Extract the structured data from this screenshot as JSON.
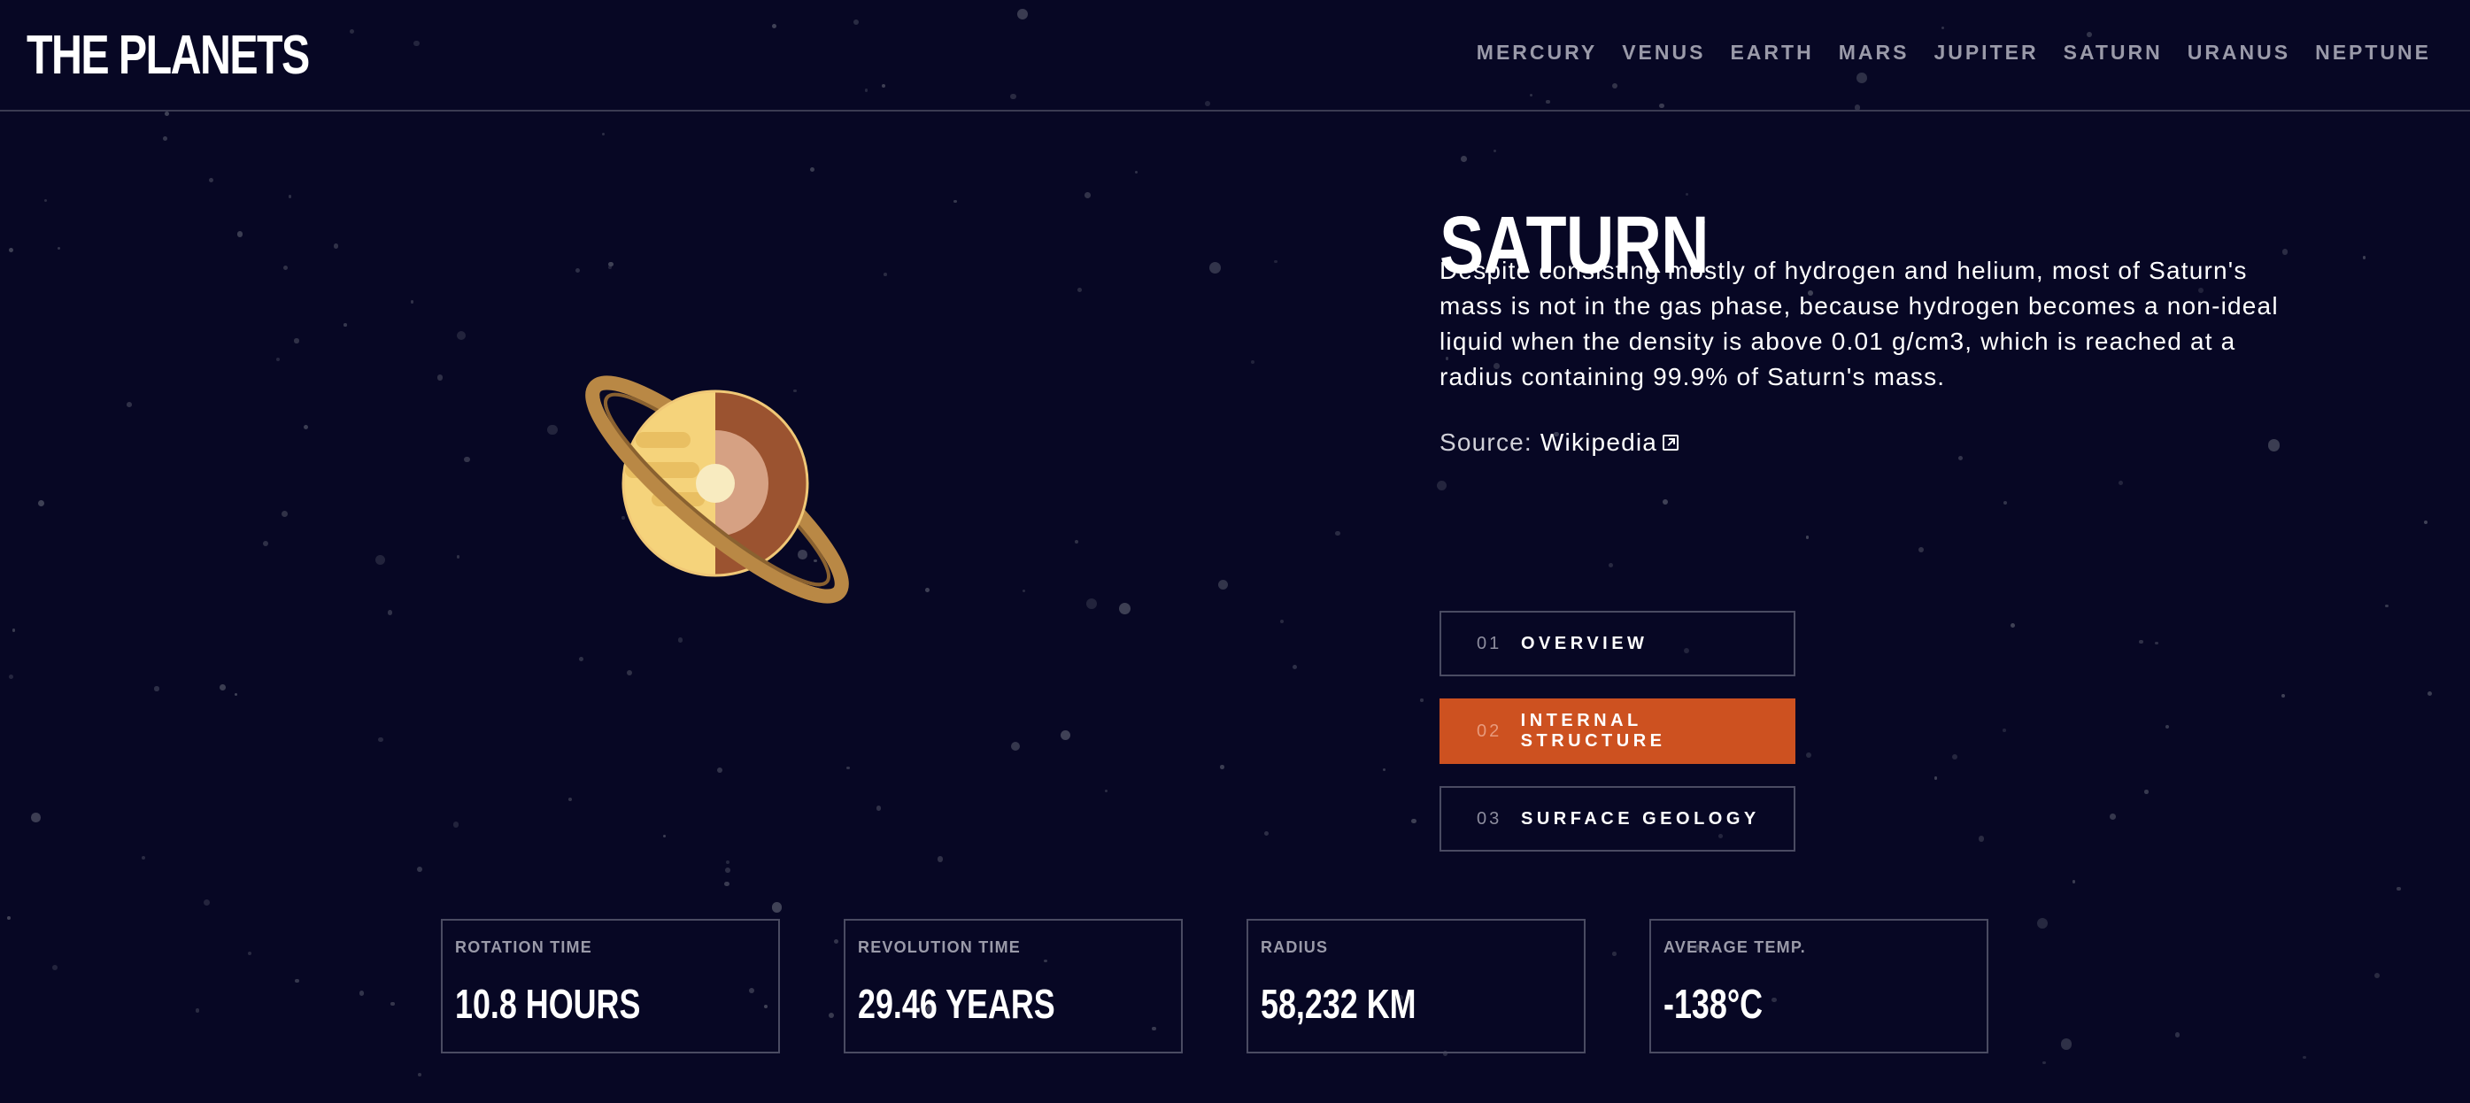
{
  "header": {
    "logo": "THE PLANETS",
    "nav": [
      "MERCURY",
      "VENUS",
      "EARTH",
      "MARS",
      "JUPITER",
      "SATURN",
      "URANUS",
      "NEPTUNE"
    ]
  },
  "planet": {
    "name": "SATURN",
    "description": "Despite consisting mostly of hydrogen and helium, most of Saturn's mass is not in the gas phase, because hydrogen becomes a non-ideal liquid when the density is above 0.01 g/cm3, which is reached at a radius containing 99.9% of Saturn's mass.",
    "source_label": "Source:",
    "source_link": "Wikipedia",
    "source_icon": "external-link-icon"
  },
  "tabs": [
    {
      "num": "01",
      "label": "OVERVIEW",
      "active": false
    },
    {
      "num": "02",
      "label": "INTERNAL STRUCTURE",
      "active": true
    },
    {
      "num": "03",
      "label": "SURFACE GEOLOGY",
      "active": false
    }
  ],
  "stats": [
    {
      "label": "ROTATION TIME",
      "value": "10.8 HOURS"
    },
    {
      "label": "REVOLUTION TIME",
      "value": "29.46 YEARS"
    },
    {
      "label": "RADIUS",
      "value": "58,232 KM"
    },
    {
      "label": "AVERAGE TEMP.",
      "value": "-138°C"
    }
  ],
  "colors": {
    "background": "#070724",
    "accent": "#CD5120",
    "saturn_light": "#F5D37B",
    "saturn_dark": "#9B5330",
    "ring": "#B98845"
  }
}
